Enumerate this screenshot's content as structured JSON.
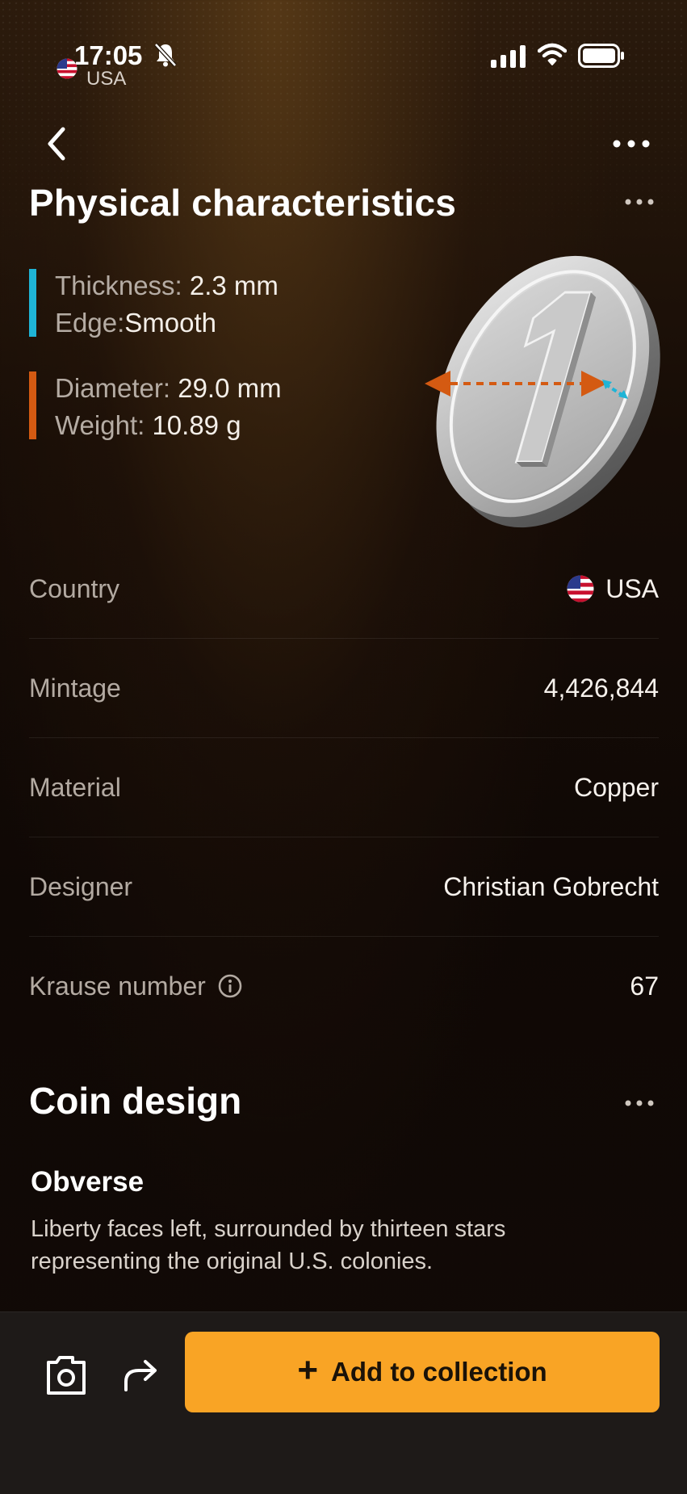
{
  "status_bar": {
    "time": "17:05",
    "country": "USA",
    "icons": [
      "us-flag-icon",
      "bell-muted-icon",
      "cellular-signal-icon",
      "wifi-icon",
      "battery-icon"
    ]
  },
  "header": {
    "back_icon": "chevron-left-icon",
    "more_icon": "more-horizontal-icon"
  },
  "physical": {
    "title": "Physical characteristics",
    "specs": [
      {
        "label": "Thickness:",
        "value": "2.3 mm"
      },
      {
        "label": "Edge:",
        "value": "Smooth"
      },
      {
        "label": "Diameter:",
        "value": "29.0 mm"
      },
      {
        "label": "Weight:",
        "value": "10.89 g"
      }
    ],
    "colors": {
      "thickness_accent": "#1fb4d6",
      "diameter_accent": "#d45a12"
    },
    "coin_glyph": "1"
  },
  "details": [
    {
      "label": "Country",
      "value": "USA",
      "icon": "us-flag-icon"
    },
    {
      "label": "Mintage",
      "value": "4,426,844"
    },
    {
      "label": "Material",
      "value": "Copper"
    },
    {
      "label": "Designer",
      "value": "Christian Gobrecht"
    },
    {
      "label": "Krause number",
      "value": "67",
      "icon": "info-icon"
    }
  ],
  "design": {
    "title": "Coin design",
    "obverse_title": "Obverse",
    "obverse_text": "Liberty faces left, surrounded by thirteen stars representing the original U.S. colonies."
  },
  "actions": {
    "camera_icon": "camera-icon",
    "share_icon": "share-arrow-icon",
    "add_label": "Add to collection",
    "add_icon": "+",
    "accent": "#f9a425"
  }
}
